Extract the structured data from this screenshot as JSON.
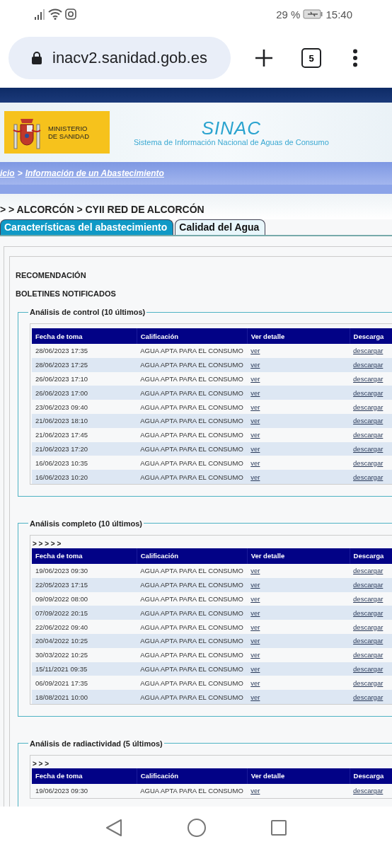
{
  "status_bar": {
    "battery": "29 %",
    "time": "15:40"
  },
  "browser": {
    "url": "inacv2.sanidad.gob.es",
    "tab_count": "5"
  },
  "header": {
    "ministry": [
      "MINISTERIO",
      "DE SANIDAD"
    ],
    "logo": "SINAC",
    "subtitle": "Sistema de Información Nacional de Aguas de Consumo"
  },
  "breadcrumb": {
    "links": [
      "icio",
      "Información de un Abastecimiento"
    ],
    "separator": ">"
  },
  "location": "> > ALCORCÓN > CYII RED DE ALCORCÓN",
  "tabs": [
    {
      "label": "Características del abastecimiento",
      "selected": false
    },
    {
      "label": "Calidad del Agua",
      "selected": true
    }
  ],
  "headings": [
    "RECOMENDACIÓN",
    "BOLETINES NOTIFICADOS"
  ],
  "sections": [
    {
      "title": "Análisis de control (10 últimos)",
      "columns": [
        "Fecha de toma",
        "Calificación",
        "Ver detalle",
        "Descarga"
      ],
      "rows": [
        {
          "date": "28/06/2023 17:35",
          "rating": "AGUA APTA PARA EL CONSUMO",
          "detail": "ver",
          "download": "descargar"
        },
        {
          "date": "28/06/2023 17:25",
          "rating": "AGUA APTA PARA EL CONSUMO",
          "detail": "ver",
          "download": "descargar"
        },
        {
          "date": "26/06/2023 17:10",
          "rating": "AGUA APTA PARA EL CONSUMO",
          "detail": "ver",
          "download": "descargar"
        },
        {
          "date": "26/06/2023 17:00",
          "rating": "AGUA APTA PARA EL CONSUMO",
          "detail": "ver",
          "download": "descargar"
        },
        {
          "date": "23/06/2023 09:40",
          "rating": "AGUA APTA PARA EL CONSUMO",
          "detail": "ver",
          "download": "descargar"
        },
        {
          "date": "21/06/2023 18:10",
          "rating": "AGUA APTA PARA EL CONSUMO",
          "detail": "ver",
          "download": "descargar"
        },
        {
          "date": "21/06/2023 17:45",
          "rating": "AGUA APTA PARA EL CONSUMO",
          "detail": "ver",
          "download": "descargar"
        },
        {
          "date": "21/06/2023 17:20",
          "rating": "AGUA APTA PARA EL CONSUMO",
          "detail": "ver",
          "download": "descargar"
        },
        {
          "date": "16/06/2023 10:35",
          "rating": "AGUA APTA PARA EL CONSUMO",
          "detail": "ver",
          "download": "descargar"
        },
        {
          "date": "16/06/2023 10:20",
          "rating": "AGUA APTA PARA EL CONSUMO",
          "detail": "ver",
          "download": "descargar"
        }
      ]
    },
    {
      "title": "Análisis completo (10 últimos)",
      "path": "> > > > >",
      "columns": [
        "Fecha de toma",
        "Calificación",
        "Ver detalle",
        "Descarga"
      ],
      "rows": [
        {
          "date": "19/06/2023 09:30",
          "rating": "AGUA APTA PARA EL CONSUMO",
          "detail": "ver",
          "download": "descargar"
        },
        {
          "date": "22/05/2023 17:15",
          "rating": "AGUA APTA PARA EL CONSUMO",
          "detail": "ver",
          "download": "descargar"
        },
        {
          "date": "09/09/2022 08:00",
          "rating": "AGUA APTA PARA EL CONSUMO",
          "detail": "ver",
          "download": "descargar"
        },
        {
          "date": "07/09/2022 20:15",
          "rating": "AGUA APTA PARA EL CONSUMO",
          "detail": "ver",
          "download": "descargar"
        },
        {
          "date": "22/06/2022 09:40",
          "rating": "AGUA APTA PARA EL CONSUMO",
          "detail": "ver",
          "download": "descargar"
        },
        {
          "date": "20/04/2022 10:25",
          "rating": "AGUA APTA PARA EL CONSUMO",
          "detail": "ver",
          "download": "descargar"
        },
        {
          "date": "30/03/2022 10:25",
          "rating": "AGUA APTA PARA EL CONSUMO",
          "detail": "ver",
          "download": "descargar"
        },
        {
          "date": "15/11/2021 09:35",
          "rating": "AGUA APTA PARA EL CONSUMO",
          "detail": "ver",
          "download": "descargar"
        },
        {
          "date": "06/09/2021 17:35",
          "rating": "AGUA APTA PARA EL CONSUMO",
          "detail": "ver",
          "download": "descargar"
        },
        {
          "date": "18/08/2021 10:00",
          "rating": "AGUA APTA PARA EL CONSUMO",
          "detail": "ver",
          "download": "descargar"
        }
      ]
    },
    {
      "title": "Análisis de radiactividad (5 últimos)",
      "path": "> > >",
      "columns": [
        "Fecha de toma",
        "Calificación",
        "Ver detalle",
        "Descarga"
      ],
      "rows": [
        {
          "date": "19/06/2023 09:30",
          "rating": "AGUA APTA PARA EL CONSUMO",
          "detail": "ver",
          "download": "descargar"
        }
      ]
    }
  ]
}
